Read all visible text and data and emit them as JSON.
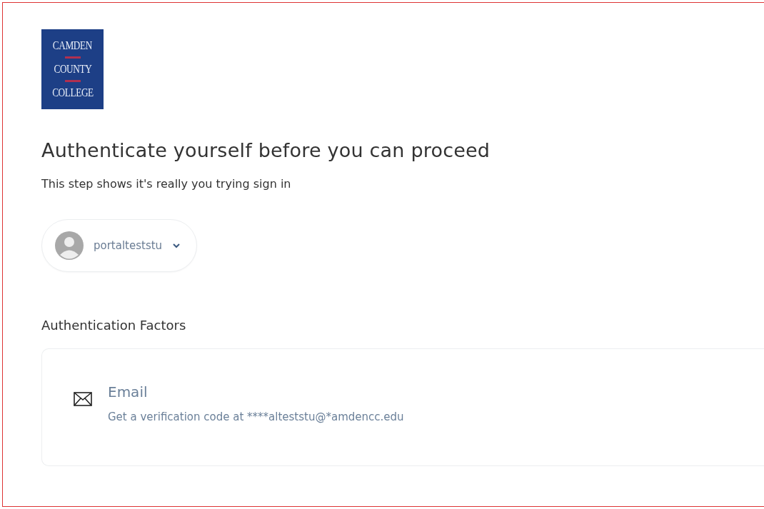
{
  "logo": {
    "lines": [
      "CAMDEN",
      "COUNTY",
      "COLLEGE"
    ]
  },
  "heading": "Authenticate yourself before you can proceed",
  "subheading": "This step shows it's really you trying sign in",
  "account": {
    "username": "portalteststu"
  },
  "factors_heading": "Authentication Factors",
  "factors": [
    {
      "kind": "email",
      "title": "Email",
      "description": "Get a verification code at ****alteststu@*amdencc.edu"
    }
  ]
}
